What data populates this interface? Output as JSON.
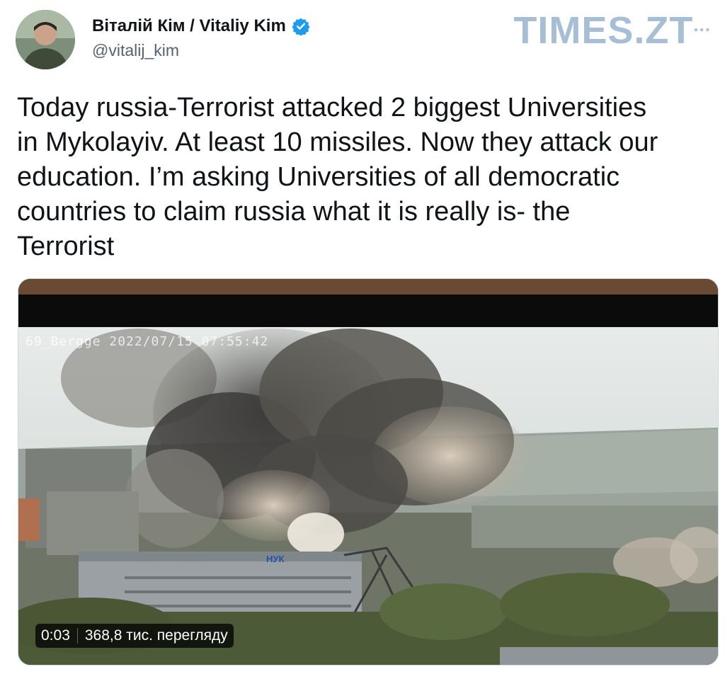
{
  "author": {
    "display_name": "Віталій Кім / Vitaliy Kim",
    "handle": "@vitalij_kim",
    "verified": true,
    "avatar_icon": "user-avatar"
  },
  "watermark": {
    "text": "TIMES.ZT",
    "dots": "..."
  },
  "tweet": {
    "text": "Today russia-Terrorist attacked 2 biggest Universities\nin Mykolayiv. At least 10 missiles. Now they attack our\neducation. I’m asking Universities of all democratic\ncountries to claim russia what it is really is- the\nTerrorist"
  },
  "media": {
    "camera_timestamp": "69_Bergge 2022/07/15 07:55:42",
    "building_sign": "НУК",
    "video_time": "0:03",
    "views": "368,8 тис. перегляду"
  },
  "colors": {
    "verified_blue": "#1d9bf0",
    "handle_gray": "#536471",
    "watermark_blue": "#a7bfd6"
  }
}
